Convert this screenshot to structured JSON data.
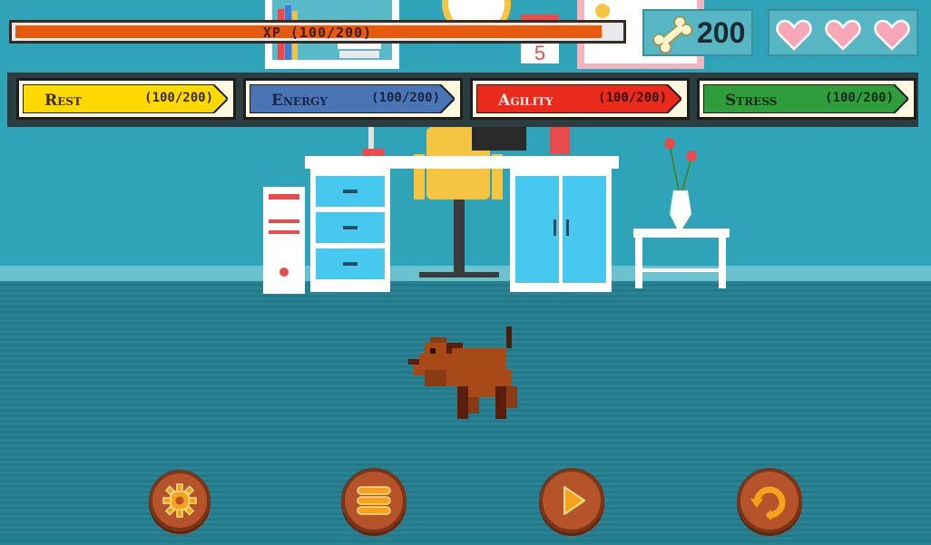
{
  "hud": {
    "xp_label": "XP (100/200)",
    "xp_progress": 0.97,
    "bones_count": "200",
    "bones_icon": "bone-icon",
    "hearts": 3,
    "heart_icon": "heart-icon"
  },
  "stats": [
    {
      "name": "Rest",
      "value": "(100/200)",
      "color": "#ffd900"
    },
    {
      "name": "Energy",
      "value": "(100/200)",
      "color": "#4a75b5"
    },
    {
      "name": "Agility",
      "value": "(100/200)",
      "color": "#ea2a1a"
    },
    {
      "name": "Stress",
      "value": "(100/200)",
      "color": "#2f9d3c"
    }
  ],
  "controls": {
    "settings_icon": "gear-icon",
    "menu_icon": "menu-icon",
    "play_icon": "play-icon",
    "restart_icon": "restart-icon"
  },
  "scene": {
    "calendar_day": "5"
  }
}
